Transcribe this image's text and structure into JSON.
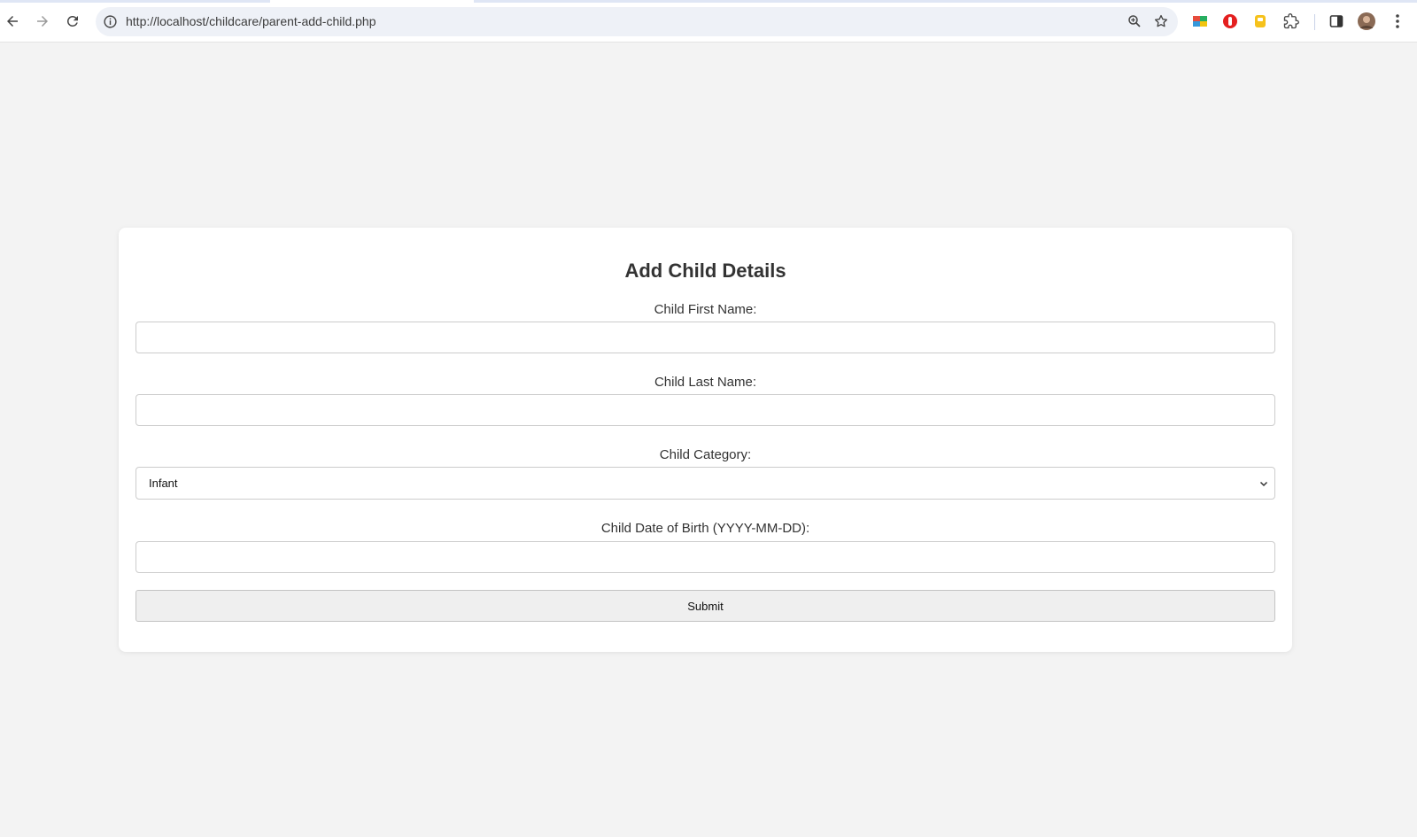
{
  "browser": {
    "url": "http://localhost/childcare/parent-add-child.php",
    "icons": [
      "back-arrow-icon",
      "forward-arrow-icon",
      "reload-icon",
      "site-info-icon",
      "zoom-icon",
      "bookmark-star-icon",
      "extension-color-icon",
      "extension-red-icon",
      "extension-yellow-icon",
      "puzzle-icon",
      "side-panel-icon",
      "avatar",
      "kebab-menu-icon"
    ]
  },
  "form": {
    "title": "Add Child Details",
    "first_name_label": "Child First Name:",
    "first_name_value": "",
    "last_name_label": "Child Last Name:",
    "last_name_value": "",
    "category_label": "Child Category:",
    "category_selected": "Infant",
    "dob_label": "Child Date of Birth (YYYY-MM-DD):",
    "dob_value": "",
    "submit_label": "Submit"
  },
  "colors": {
    "page_bg": "#f3f3f3",
    "card_bg": "#ffffff",
    "button_bg": "#efefef",
    "text": "#333333"
  }
}
